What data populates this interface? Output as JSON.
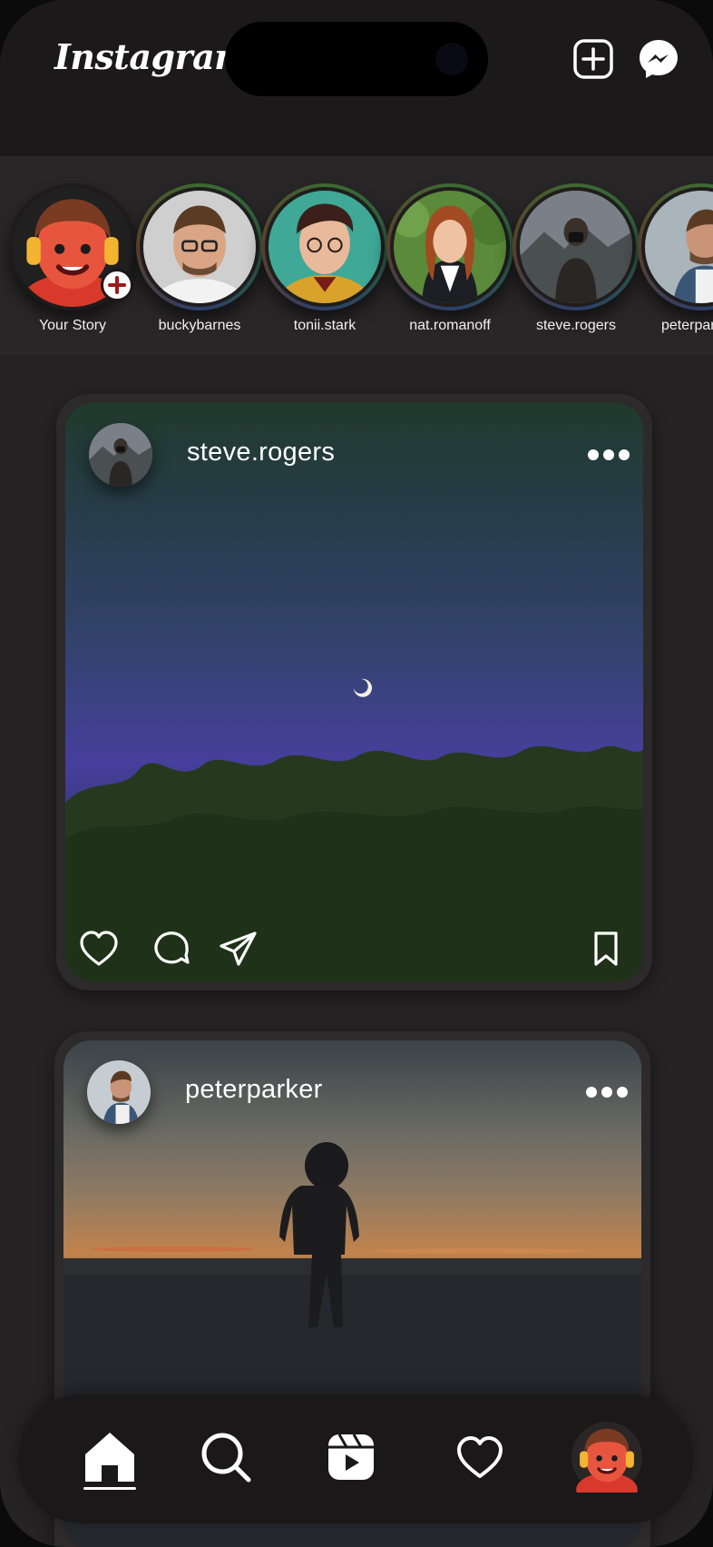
{
  "app": {
    "title": "Instagram"
  },
  "header": {
    "logo": "Instagram",
    "create_icon": "plus-square-icon",
    "messenger_icon": "messenger-icon"
  },
  "stories": [
    {
      "name": "Your Story",
      "has_add": true
    },
    {
      "name": "buckybarnes"
    },
    {
      "name": "tonii.stark"
    },
    {
      "name": "nat.romanoff"
    },
    {
      "name": "steve.rogers"
    },
    {
      "name": "peterparker"
    }
  ],
  "posts": [
    {
      "username": "steve.rogers",
      "menu_icon": "more-horizontal-icon",
      "actions": [
        "heart-icon",
        "comment-icon",
        "send-icon",
        "bookmark-icon"
      ]
    },
    {
      "username": "peterparker",
      "menu_icon": "more-horizontal-icon"
    }
  ],
  "nav": {
    "items": [
      "home-icon",
      "search-icon",
      "reels-icon",
      "heart-icon",
      "profile-avatar"
    ],
    "active": "home-icon"
  },
  "colors": {
    "background": "#252323",
    "header": "#1b1919",
    "nav": "#1a1818",
    "text": "#ffffff"
  }
}
